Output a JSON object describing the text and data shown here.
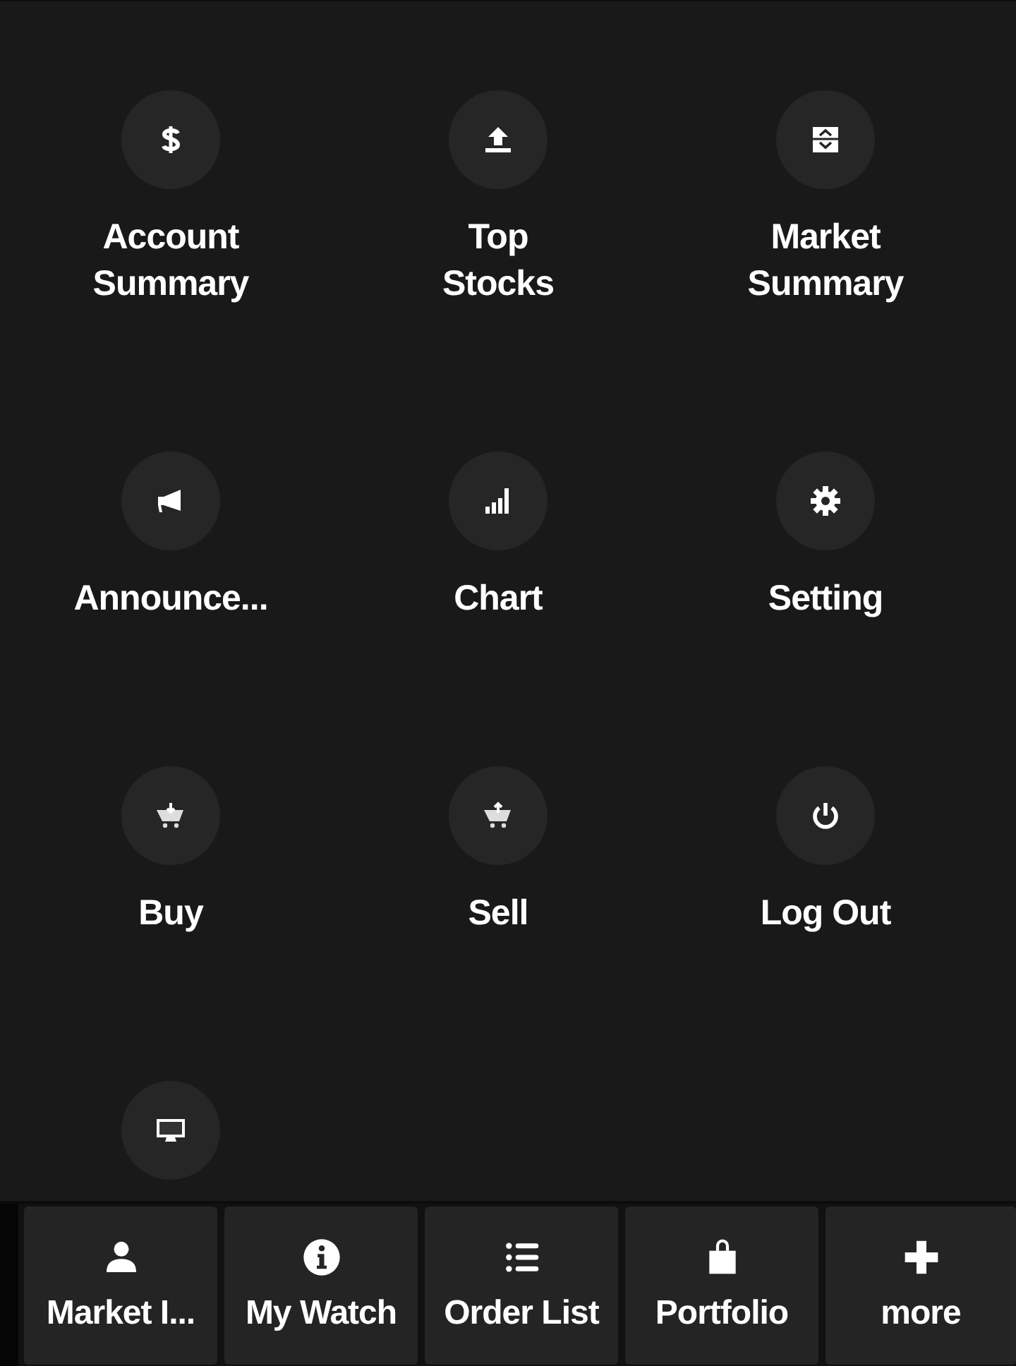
{
  "menu": [
    {
      "label": "Account Summary",
      "kind": "dollar"
    },
    {
      "label": "Top Stocks",
      "kind": "upload"
    },
    {
      "label": "Market Summary",
      "kind": "updown"
    },
    {
      "label": "Announce...",
      "kind": "megaphone"
    },
    {
      "label": "Chart",
      "kind": "bars"
    },
    {
      "label": "Setting",
      "kind": "gear"
    },
    {
      "label": "Buy",
      "kind": "cart-in"
    },
    {
      "label": "Sell",
      "kind": "cart-out"
    },
    {
      "label": "Log Out",
      "kind": "power"
    },
    {
      "kind": "monitor"
    }
  ],
  "tab_bar": [
    {
      "label": "Market I...",
      "kind": "user"
    },
    {
      "label": "My Watch",
      "kind": "info"
    },
    {
      "label": "Order List",
      "kind": "list"
    },
    {
      "label": "Portfolio",
      "kind": "bag"
    },
    {
      "label": "more",
      "kind": "plus"
    }
  ]
}
